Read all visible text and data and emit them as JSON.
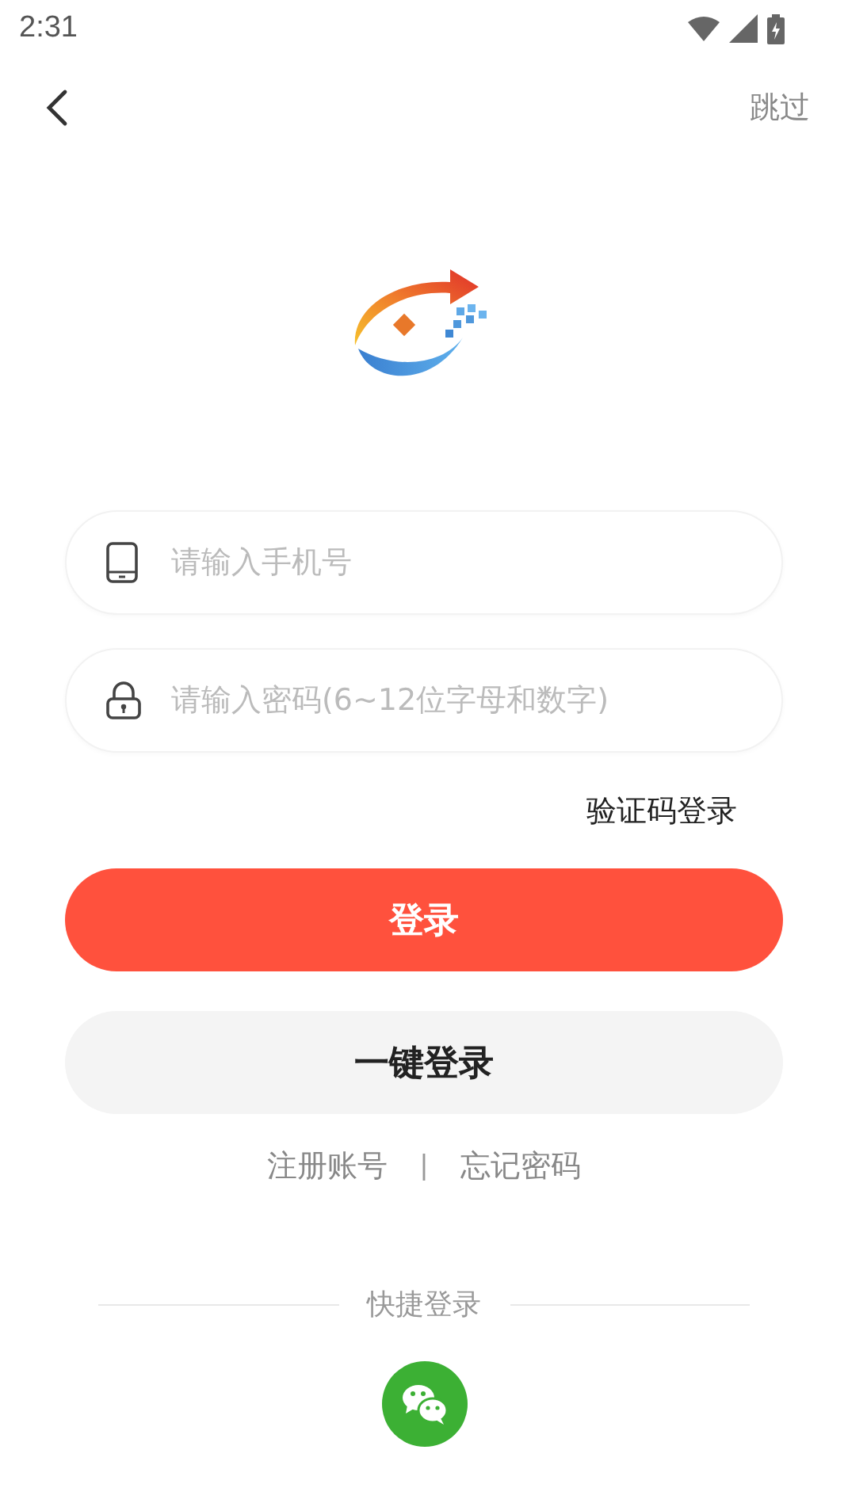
{
  "status_bar": {
    "time": "2:31"
  },
  "header": {
    "skip": "跳过"
  },
  "fields": [
    {
      "kind": "phone",
      "placeholder": "请输入手机号"
    },
    {
      "kind": "password",
      "placeholder": "请输入密码(6~12位字母和数字)"
    }
  ],
  "code_login": "验证码登录",
  "buttons": [
    {
      "kind": "primary",
      "label": "登录"
    },
    {
      "kind": "secondary",
      "label": "一键登录"
    }
  ],
  "links": {
    "register": "注册账号",
    "separator": "|",
    "forgot": "忘记密码"
  },
  "quick_login": {
    "title": "快捷登录"
  }
}
